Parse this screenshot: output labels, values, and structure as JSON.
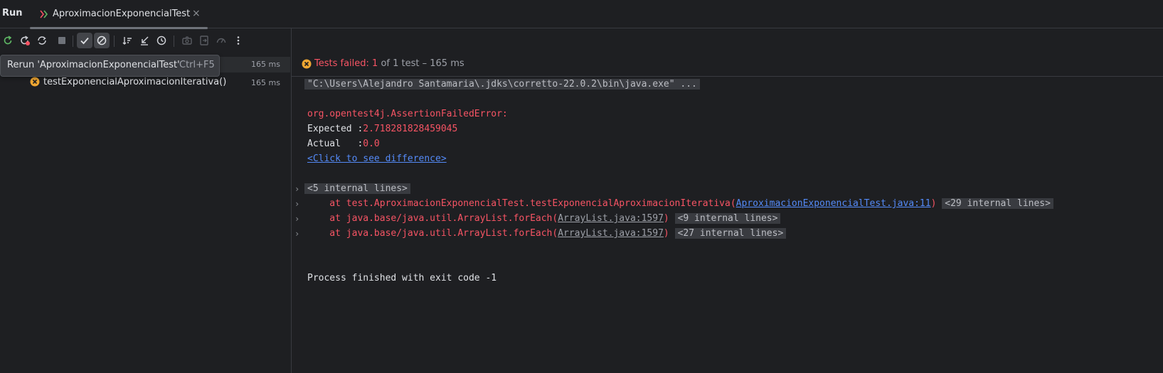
{
  "header": {
    "run_label": "Run",
    "tab_title": "AproximacionExponencialTest",
    "tab_close": "×"
  },
  "toolbar": {
    "buttons": [
      {
        "name": "rerun-icon"
      },
      {
        "name": "rerun-failed-icon"
      },
      {
        "name": "toggle-auto-test-icon"
      },
      {
        "name": "stop-icon"
      },
      {
        "name": "show-passed-icon"
      },
      {
        "name": "show-ignored-icon"
      },
      {
        "name": "sort-icon"
      },
      {
        "name": "collapse-icon"
      },
      {
        "name": "history-icon"
      },
      {
        "name": "screenshot-icon"
      },
      {
        "name": "export-icon"
      },
      {
        "name": "coverage-icon"
      },
      {
        "name": "more-icon"
      }
    ]
  },
  "tooltip": {
    "text": "Rerun 'AproximacionExponencialTest'",
    "shortcut": "Ctrl+F5"
  },
  "tree": {
    "root_time": "165 ms",
    "child_label": "testExponencialAproximacionIterativa()",
    "child_time": "165 ms"
  },
  "status": {
    "failed_label": "Tests failed:",
    "failed_count": "1",
    "of_text": "of 1 test – 165 ms"
  },
  "console": {
    "command": "\"C:\\Users\\Alejandro Santamaria\\.jdks\\corretto-22.0.2\\bin\\java.exe\" ...",
    "error_class": "org.opentest4j.AssertionFailedError:",
    "expected_label": "Expected :",
    "expected_value": "2.718281828459045",
    "actual_label": "Actual   :",
    "actual_value": "0.0",
    "diff_link": "<Click to see difference>",
    "fold1": "<5 internal lines>",
    "trace1_prefix": "    at test.AproximacionExponencialTest.testExponencialAproximacionIterativa(",
    "trace1_link": "AproximacionExponencialTest.java:11",
    "trace1_suffix": ")",
    "trace1_fold": "<29 internal lines>",
    "trace2_prefix": "    at java.base/java.util.ArrayList.forEach(",
    "trace2_link": "ArrayList.java:1597",
    "trace2_suffix": ")",
    "trace2_fold": "<9 internal lines>",
    "trace3_prefix": "    at java.base/java.util.ArrayList.forEach(",
    "trace3_link": "ArrayList.java:1597",
    "trace3_suffix": ")",
    "trace3_fold": "<27 internal lines>",
    "chevron": "›",
    "finish": "Process finished with exit code -1"
  },
  "colors": {
    "background": "#1e1f22",
    "error_red": "#f75464",
    "link_blue": "#548af7",
    "fail_badge": "#f0a732"
  }
}
